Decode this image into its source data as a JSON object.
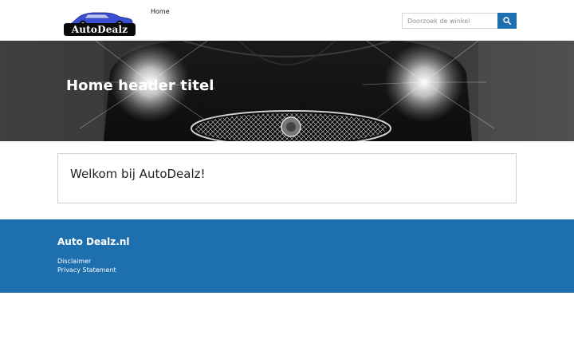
{
  "header": {
    "logo_text": "AutoDealz",
    "nav": {
      "home_label": "Home"
    },
    "search": {
      "placeholder": "Doorzoek de winkel",
      "button_icon": "search-icon"
    }
  },
  "hero": {
    "title": "Home header titel"
  },
  "main": {
    "welcome_text": "Welkom bij AutoDealz!"
  },
  "footer": {
    "title": "Auto Dealz.nl",
    "links": [
      {
        "label": "Disclaimer"
      },
      {
        "label": "Privacy Statement"
      }
    ]
  },
  "colors": {
    "brand_blue": "#1e6fae",
    "search_button": "#1e6fb0",
    "logo_car": "#3a4fd6"
  }
}
